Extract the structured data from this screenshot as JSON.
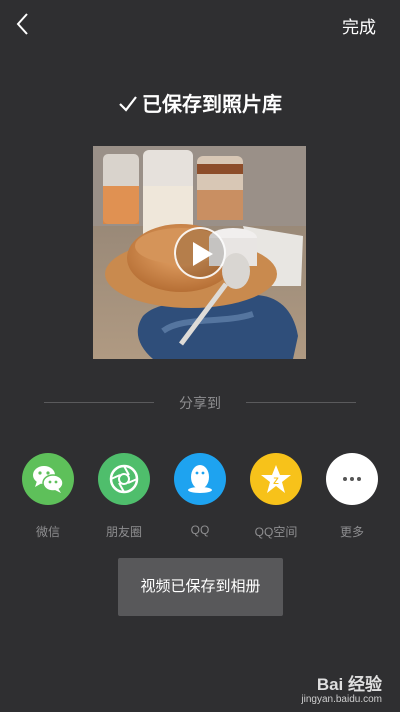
{
  "header": {
    "done_label": "完成"
  },
  "status": {
    "title": "已保存到照片库"
  },
  "share": {
    "heading": "分享到",
    "targets": [
      {
        "label": "微信",
        "icon": "wechat-icon",
        "color": "#5ec05a"
      },
      {
        "label": "朋友圈",
        "icon": "moments-icon",
        "color": "#4fbe6c"
      },
      {
        "label": "QQ",
        "icon": "qq-icon",
        "color": "#1ea3f0"
      },
      {
        "label": "QQ空间",
        "icon": "qzone-icon",
        "color": "#f7c21a"
      },
      {
        "label": "更多",
        "icon": "more-icon",
        "color": "#ffffff"
      }
    ]
  },
  "toast": {
    "message": "视频已保存到相册"
  },
  "watermark": {
    "brand": "Bai 经验",
    "url": "jingyan.baidu.com"
  }
}
